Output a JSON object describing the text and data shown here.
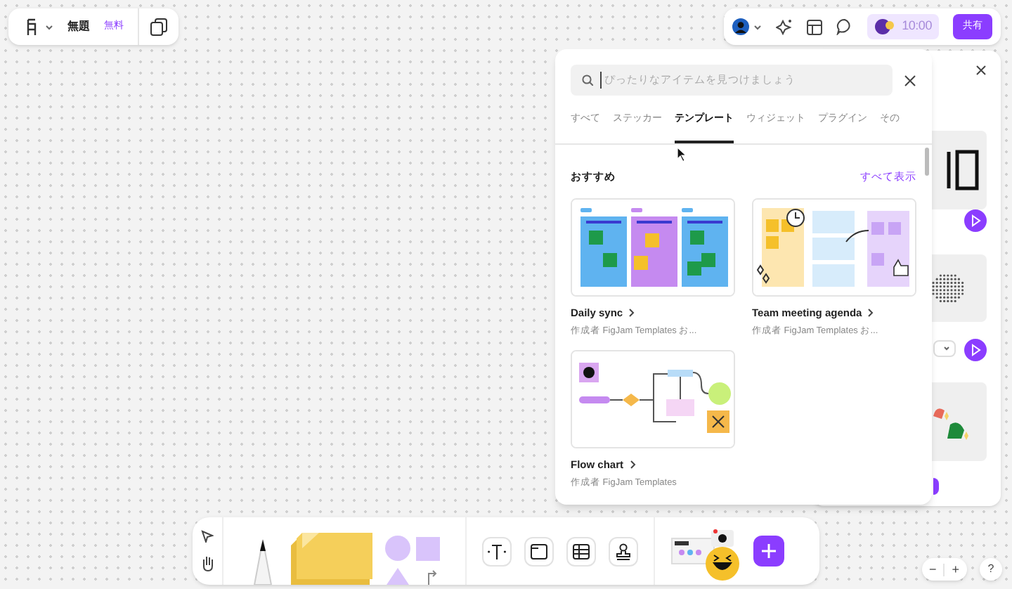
{
  "file_bar": {
    "title": "無題",
    "plan_badge": "無料"
  },
  "top_right": {
    "timer": "10:00",
    "share_button": "共有"
  },
  "panel": {
    "search": {
      "placeholder": "ぴったりなアイテムを見つけましょう"
    },
    "tabs": [
      {
        "label": "すべて",
        "selected": false
      },
      {
        "label": "ステッカー",
        "selected": false
      },
      {
        "label": "テンプレート",
        "selected": true
      },
      {
        "label": "ウィジェット",
        "selected": false
      },
      {
        "label": "プラグイン",
        "selected": false
      },
      {
        "label": "その",
        "selected": false
      }
    ],
    "section_title": "おすすめ",
    "see_all": "すべて表示",
    "templates": [
      {
        "kind": "daily",
        "title": "Daily sync",
        "author": "作成者 FigJam Templates お..."
      },
      {
        "kind": "meeting",
        "title": "Team meeting agenda",
        "author": "作成者 FigJam Templates お..."
      },
      {
        "kind": "flow",
        "title": "Flow chart",
        "author": "作成者 FigJam Templates"
      }
    ]
  },
  "zoom_controls": [
    "−",
    "+"
  ],
  "help": "?"
}
